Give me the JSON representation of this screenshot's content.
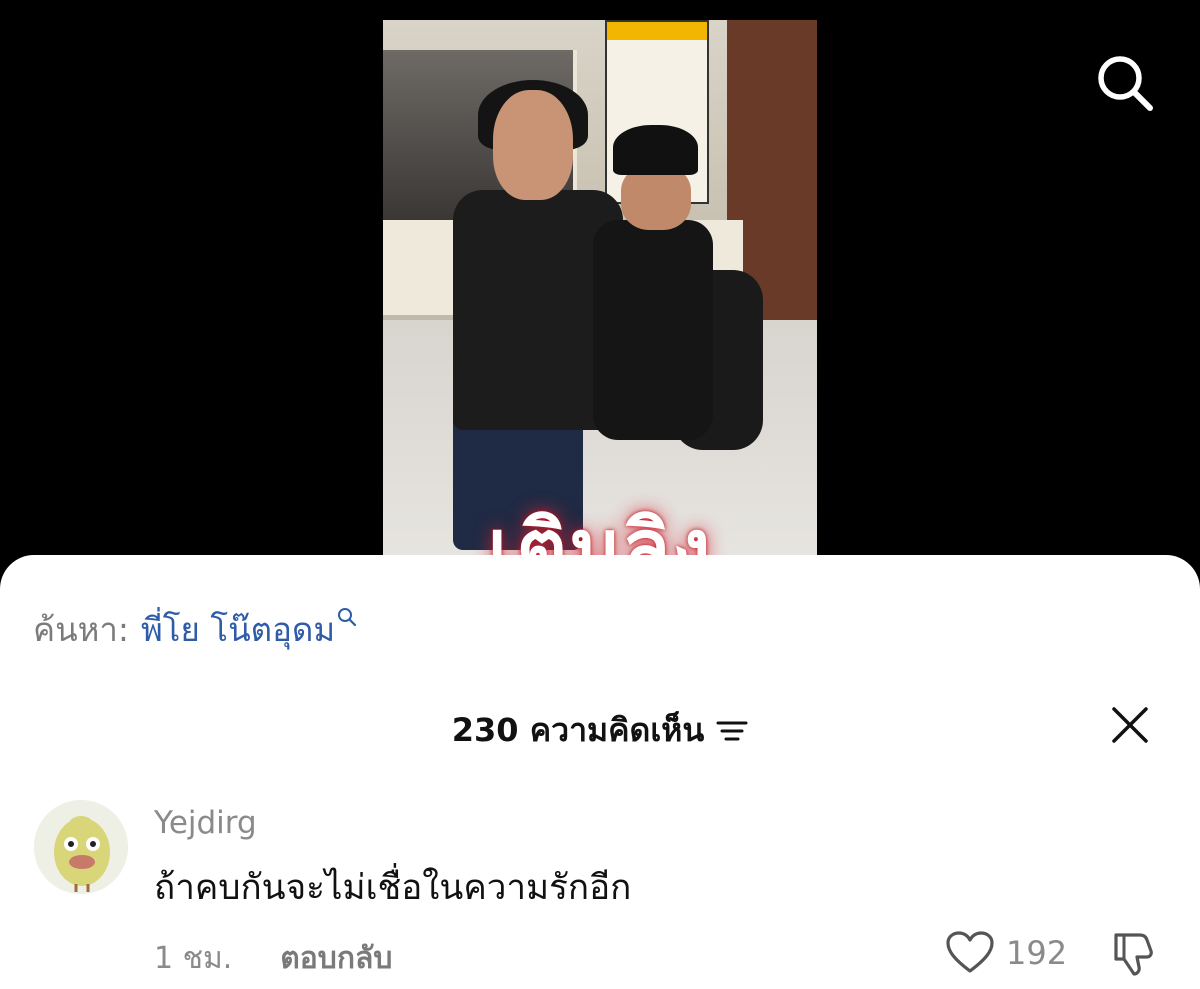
{
  "video": {
    "overlay_text": "เติมลิง"
  },
  "top_bar": {
    "search_icon": "search-icon"
  },
  "sheet": {
    "search_prefix": "ค้นหา:",
    "search_query": "พี่โย โน๊ตอุดม",
    "comments_count_label": "230 ความคิดเห็น",
    "sort_icon": "sort-icon",
    "close_icon": "close-icon"
  },
  "comments": [
    {
      "username": "Yejdirg",
      "text": "ถ้าคบกันจะไม่เชื่อในความรักอีก",
      "time": "1 ชม.",
      "reply_label": "ตอบกลับ",
      "like_count": "192",
      "like_icon": "heart-icon",
      "dislike_icon": "thumbs-down-icon"
    }
  ],
  "colors": {
    "background": "#000000",
    "sheet": "#ffffff",
    "link_blue": "#2f5ca8",
    "muted_text": "#8a8a8a"
  }
}
